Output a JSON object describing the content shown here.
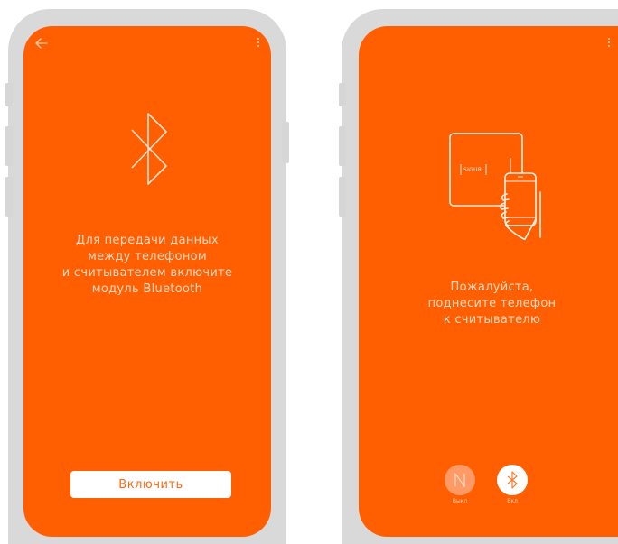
{
  "bluetooth_screen": {
    "message": "Для передачи данных\nмежду телефоном\nи считывателем включите\nмодуль Bluetooth",
    "enable_button_label": "Включить"
  },
  "reader_screen": {
    "message": "Пожалуйста,\nподнесите телефон\nк считывателю",
    "reader_logo_text": "SIGUR",
    "nfc_toggle_label": "Выкл",
    "bluetooth_toggle_label": "Вкл"
  },
  "colors": {
    "screen_background": "#ff5f00",
    "device_frame": "#d9d9d9",
    "button_background": "#ffffff"
  }
}
